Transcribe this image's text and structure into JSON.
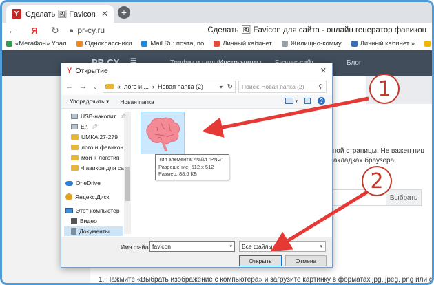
{
  "browser": {
    "tab_title": "Сделать 🖼 Favicon для сайта",
    "tab_favicon_letter": "Y",
    "url": "pr-cy.ru",
    "page_title": "Сделать 🖼 Favicon для сайта - онлайн генератор фавикон"
  },
  "bookmarks": [
    {
      "label": "«МегаФон» Урал",
      "color": "#2e9e4f"
    },
    {
      "label": "Одноклассники",
      "color": "#f2871f"
    },
    {
      "label": "Mail.Ru: почта, по",
      "color": "#168de2"
    },
    {
      "label": "Личный кабинет",
      "color": "#e84c3d"
    },
    {
      "label": "Жилищно-комму",
      "color": "#9aa2a9"
    },
    {
      "label": "Личный кабинет »",
      "color": "#3a6fb5"
    },
    {
      "label": "Погод",
      "color": "#f5b400"
    }
  ],
  "site": {
    "logo": "PR-CY",
    "nav": [
      "Трафик и цены",
      "Инструменты",
      "Бизнес-сайт",
      "Блог"
    ],
    "text": "кретной страницы. Не важен ниц и в закладках браузера",
    "choose_button": "Выбрать",
    "instruction": "1. Нажмите «Выбрать изображение с компьютера» и загрузите картинку в форматах jpg, jpeg, png или gif. Подбери"
  },
  "dialog": {
    "title": "Открытие",
    "breadcrumb_prefix": "«",
    "breadcrumb_parent": "лого и ...",
    "breadcrumb_sep": "›",
    "breadcrumb_current": "Новая папка (2)",
    "search_placeholder": "Поиск: Новая папка (2)",
    "organize_label": "Упорядочить ▾",
    "new_folder_label": "Новая папка",
    "tree": [
      {
        "label": "USB-накопит",
        "icon": "drive",
        "pinned": true
      },
      {
        "label": "E:\\",
        "icon": "drive",
        "pinned": true
      },
      {
        "label": "UMKA 27-279",
        "icon": "folder",
        "pinned": false
      },
      {
        "label": "лого и фавикон",
        "icon": "folder",
        "pinned": false
      },
      {
        "label": "мои + логотип",
        "icon": "folder",
        "pinned": false
      },
      {
        "label": "Фавикон для са",
        "icon": "folder",
        "pinned": false
      },
      {
        "label": "OneDrive",
        "icon": "cloud",
        "pinned": false
      },
      {
        "label": "Яндекс.Диск",
        "icon": "ydisk",
        "pinned": false
      },
      {
        "label": "Этот компьютер",
        "icon": "pc",
        "pinned": false
      },
      {
        "label": "Видео",
        "icon": "video",
        "pinned": false
      },
      {
        "label": "Документы",
        "icon": "docs",
        "pinned": false
      }
    ],
    "tooltip_lines": [
      "Тип элемента: Файл \"PNG\"",
      "Разрешение: 512 x 512",
      "Размер: 88,6 КБ"
    ],
    "filename_label": "Имя файла:",
    "filename_value": "favicon",
    "filetype_value": "Все файлы",
    "open_button": "Открыть",
    "cancel_button": "Отмена"
  },
  "annotations": {
    "marker_1": "1",
    "marker_2": "2",
    "accent_color": "#e53935"
  }
}
